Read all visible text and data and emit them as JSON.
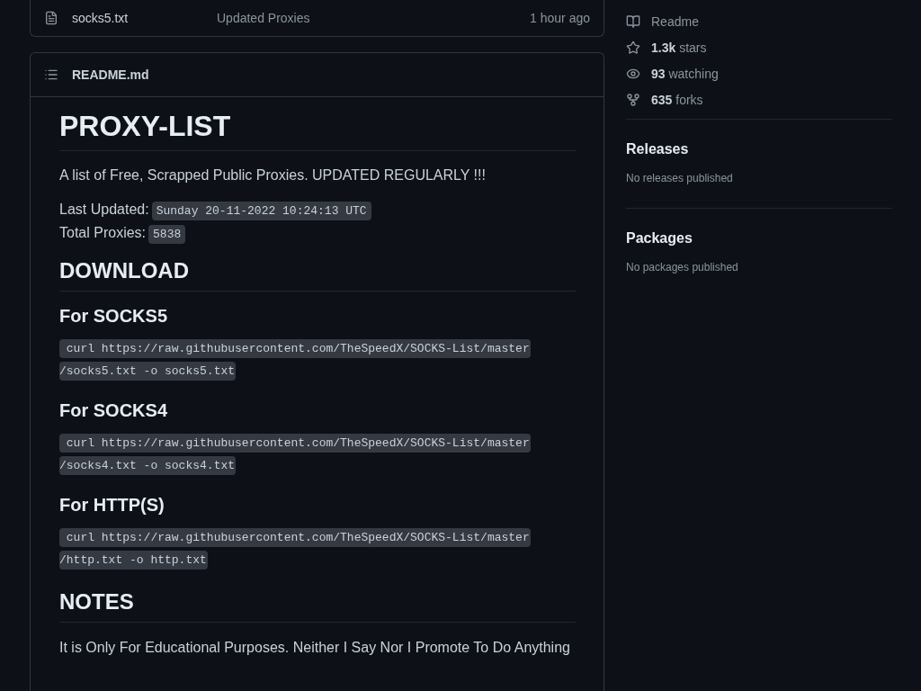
{
  "file_row": {
    "name": "socks5.txt",
    "message": "Updated Proxies",
    "time": "1 hour ago"
  },
  "readme": {
    "filename": "README.md",
    "blocks": [
      {
        "kind": "h1",
        "text": "PROXY-LIST"
      },
      {
        "kind": "p",
        "text": "A list of Free, Scrapped Public Proxies. UPDATED REGULARLY !!!"
      },
      {
        "kind": "meta",
        "lines": [
          {
            "label": "Last Updated:",
            "code": "Sunday 20-11-2022 10:24:13 UTC"
          },
          {
            "label": "Total Proxies:",
            "code": "5838"
          }
        ]
      },
      {
        "kind": "h2",
        "text": "DOWNLOAD"
      },
      {
        "kind": "h3",
        "text": "For SOCKS5"
      },
      {
        "kind": "code",
        "lines": [
          "curl https://raw.githubusercontent.com/TheSpeedX/SOCKS-List/master",
          "/socks5.txt -o socks5.txt"
        ]
      },
      {
        "kind": "h3",
        "text": "For SOCKS4"
      },
      {
        "kind": "code",
        "lines": [
          "curl https://raw.githubusercontent.com/TheSpeedX/SOCKS-List/master",
          "/socks4.txt -o socks4.txt"
        ]
      },
      {
        "kind": "h3",
        "text": "For HTTP(S)"
      },
      {
        "kind": "code",
        "lines": [
          "curl https://raw.githubusercontent.com/TheSpeedX/SOCKS-List/master",
          "/http.txt -o http.txt"
        ]
      },
      {
        "kind": "h2",
        "text": "NOTES"
      },
      {
        "kind": "p",
        "text": "It is Only For Educational Purposes. Neither I Say Nor I Promote To Do Anything"
      }
    ]
  },
  "sidebar": {
    "links": [
      {
        "kind": "readme",
        "text": "Readme"
      },
      {
        "kind": "stars",
        "count": "1.3k",
        "text": "stars"
      },
      {
        "kind": "watching",
        "count": "93",
        "text": "watching"
      },
      {
        "kind": "forks",
        "count": "635",
        "text": "forks"
      }
    ],
    "sections": [
      {
        "title": "Releases",
        "note": "No releases published"
      },
      {
        "title": "Packages",
        "note": "No packages published"
      }
    ]
  }
}
